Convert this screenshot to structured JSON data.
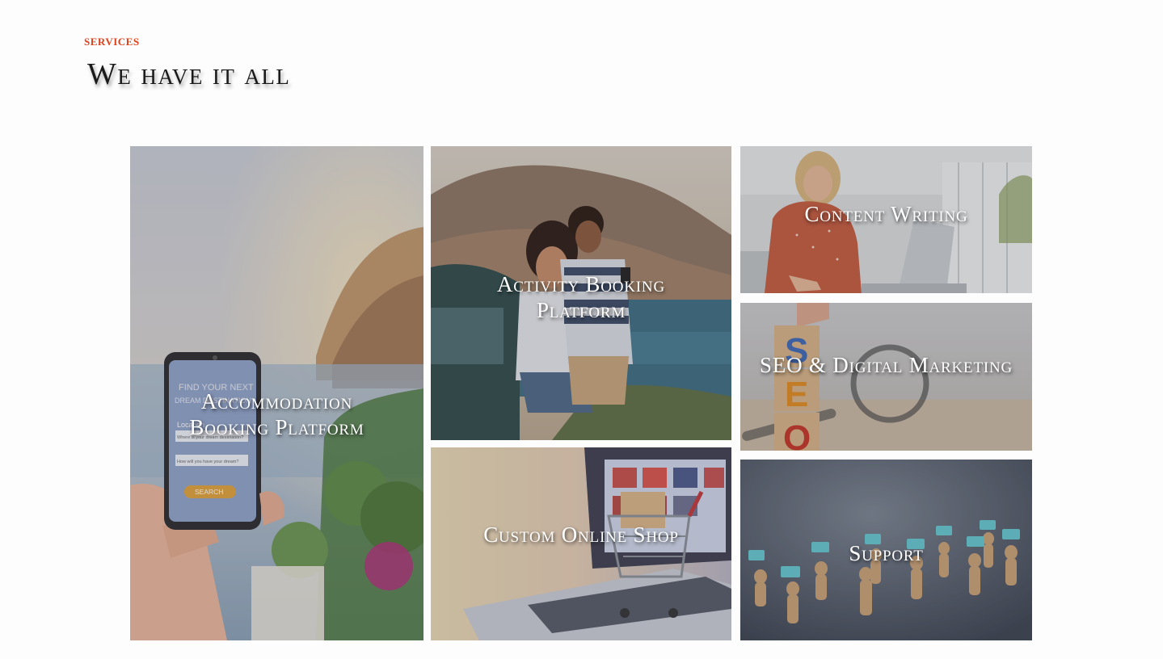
{
  "section": {
    "eyebrow": "SERVICES",
    "title": "We have it all"
  },
  "tiles": [
    {
      "label": "Accommodation Booking Platform"
    },
    {
      "label": "Activity Booking Platform"
    },
    {
      "label": "Custom Online Shop"
    },
    {
      "label": "Content Writing"
    },
    {
      "label": "SEO & Digital Marketing"
    },
    {
      "label": "Support"
    }
  ],
  "accommodation_phone": {
    "heading": "FIND YOUR NEXT",
    "heading2": "DREAM DESTINATION",
    "location_label": "Location",
    "location_placeholder": "Where is your dream destination?",
    "guests_placeholder": "How will you have your dream?",
    "search_label": "SEARCH"
  },
  "seo_blocks": [
    "S",
    "E",
    "O"
  ],
  "colors": {
    "accent": "#e0411a",
    "label": "#ffffff",
    "headline": "#1a1a1a"
  }
}
